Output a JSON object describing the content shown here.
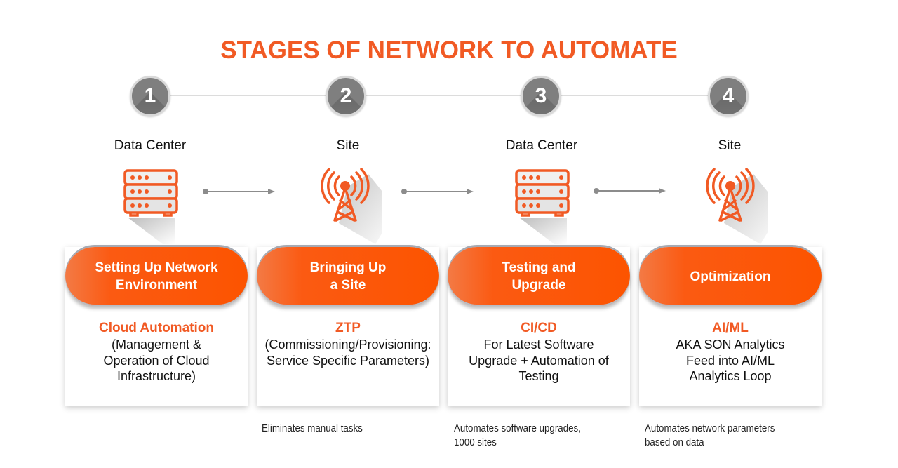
{
  "title": "STAGES OF NETWORK TO AUTOMATE",
  "colors": {
    "accent": "#f15a24",
    "pill": "#fc5400",
    "step_circle": "#7f7f7f",
    "arrow": "#8c8c8c"
  },
  "stages": [
    {
      "number": "1",
      "location": "Data Center",
      "icon": "server-rack-icon",
      "pill_label": "Setting Up Network\nEnvironment",
      "heading": "Cloud Automation",
      "description": "(Management &\nOperation of Cloud\nInfrastructure)",
      "note": ""
    },
    {
      "number": "2",
      "location": "Site",
      "icon": "cell-tower-icon",
      "pill_label": "Bringing Up\na Site",
      "heading": "ZTP",
      "description": "(Commissioning/Provisioning:\nService Specific Parameters)",
      "note": "Eliminates manual tasks"
    },
    {
      "number": "3",
      "location": "Data Center",
      "icon": "server-rack-icon",
      "pill_label": "Testing and\nUpgrade",
      "heading": "CI/CD",
      "description": "For Latest Software\nUpgrade + Automation of\nTesting",
      "note": "Automates software upgrades,\n1000 sites"
    },
    {
      "number": "4",
      "location": "Site",
      "icon": "cell-tower-icon",
      "pill_label": "Optimization",
      "heading": "AI/ML",
      "description": "AKA SON Analytics\nFeed into AI/ML\nAnalytics Loop",
      "note": "Automates network parameters\nbased on data"
    }
  ]
}
